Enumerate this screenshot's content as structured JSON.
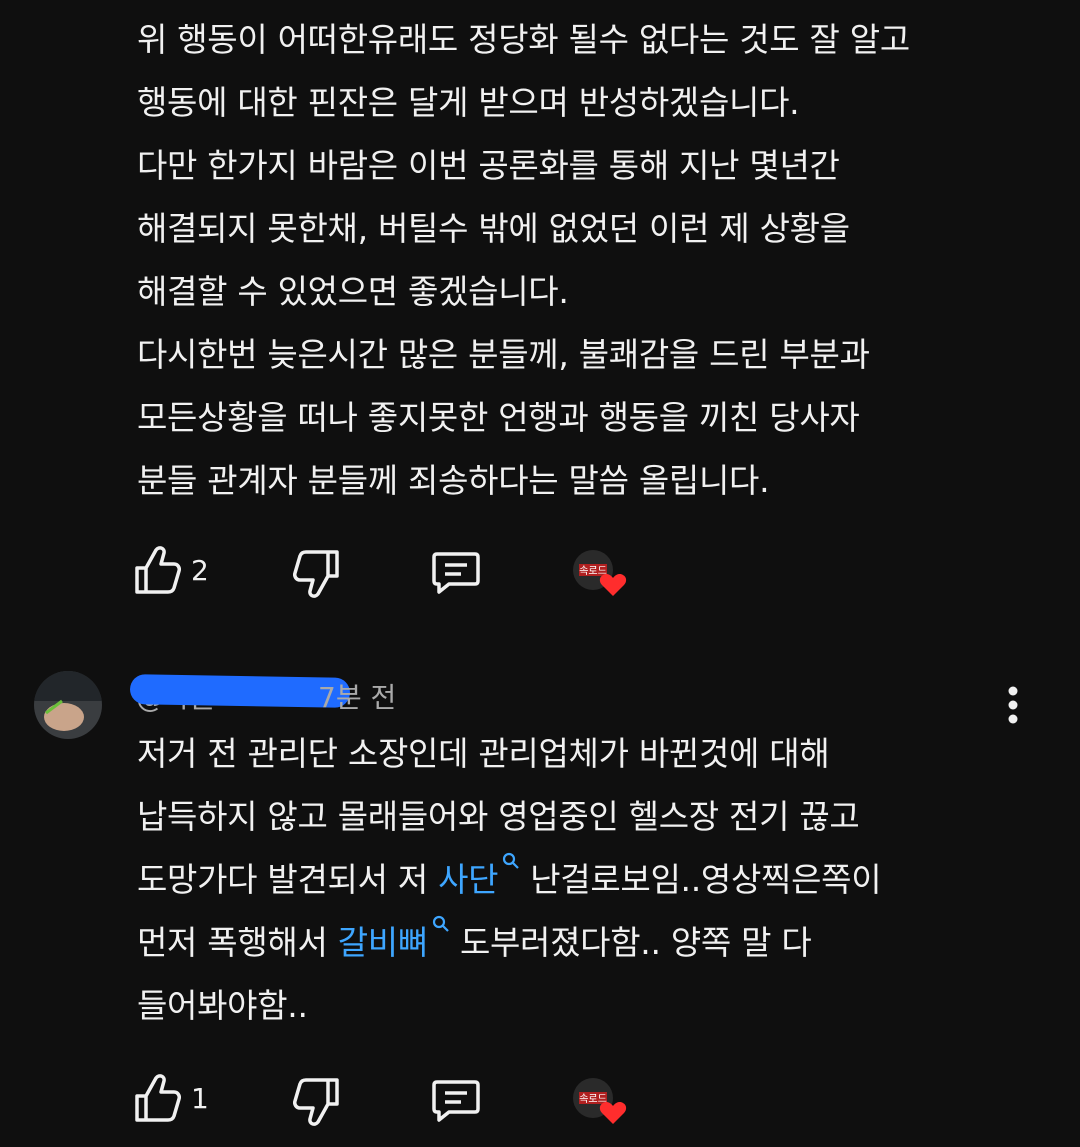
{
  "comment1": {
    "lines": [
      "위 행동이 어떠한유래도 정당화 될수 없다는 것도 잘 알고",
      "행동에 대한 핀잔은 달게 받으며 반성하겠습니다.",
      "다만 한가지 바람은 이번 공론화를 통해 지난 몇년간",
      "해결되지 못한채, 버틸수 밖에 없었던 이런 제 상황을",
      "해결할 수 있었으면 좋겠습니다.",
      "다시한번 늦은시간 많은 분들께, 불쾌감을 드린 부분과",
      "모든상황을 떠나 좋지못한 언행과 행동을 끼친 당사자",
      "분들 관계자 분들께 죄송하다는 말씀 올립니다."
    ],
    "like_count": "2",
    "creator_badge": "속로드"
  },
  "comment2": {
    "author_handle": "@나글",
    "time_suffix": "7분 전",
    "line1": "저거 전 관리단 소장인데 관리업체가 바뀐것에 대해",
    "line2": "납득하지 않고 몰래들어와 영업중인 헬스장 전기 끊고",
    "line3_a": "도망가다 발견되서 저 ",
    "line3_link": "사단",
    "line3_b": "난걸로보임..영상찍은쪽이",
    "line4_a": "먼저  폭행해서 ",
    "line4_link": "갈비뼈",
    "line4_b": "도부러졌다함.. 양쪽 말 다",
    "line5": "들어봐야함..",
    "like_count": "1",
    "creator_badge": "속로드"
  },
  "colors": {
    "background": "#0f0f0f",
    "text": "#f1f1f1",
    "link": "#3ea6ff",
    "meta": "#aaaaaa",
    "heart": "#ff2d2d",
    "redaction": "#1f6bff"
  }
}
